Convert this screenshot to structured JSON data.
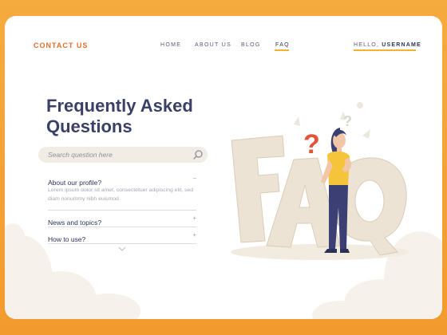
{
  "header": {
    "logo": "CONTACT US",
    "nav": [
      {
        "label": "HOME"
      },
      {
        "label": "ABOUT US"
      },
      {
        "label": "BLOG"
      },
      {
        "label": "FAQ"
      }
    ],
    "greeting": "HELLO, ",
    "username": "USERNAME"
  },
  "hero": {
    "title_line1": "Frequently Asked",
    "title_line2": "Questions"
  },
  "search": {
    "placeholder": "Search question here"
  },
  "faq": {
    "items": [
      {
        "question": "About our profile?",
        "toggle": "−",
        "answer": "Lorem ipsum dolor sit amet, consectetuer adipiscing elit, sed diam nonummy nibh euismod"
      },
      {
        "question": "News and topics?",
        "toggle": "+"
      },
      {
        "question": "How to use?",
        "toggle": "+"
      }
    ]
  },
  "illustration": {
    "letters": "FAQ",
    "question_mark": "?"
  },
  "colors": {
    "accent": "#e0702e",
    "underline": "#f3b234",
    "frame": "#f4a43c",
    "title": "#3a4066"
  }
}
